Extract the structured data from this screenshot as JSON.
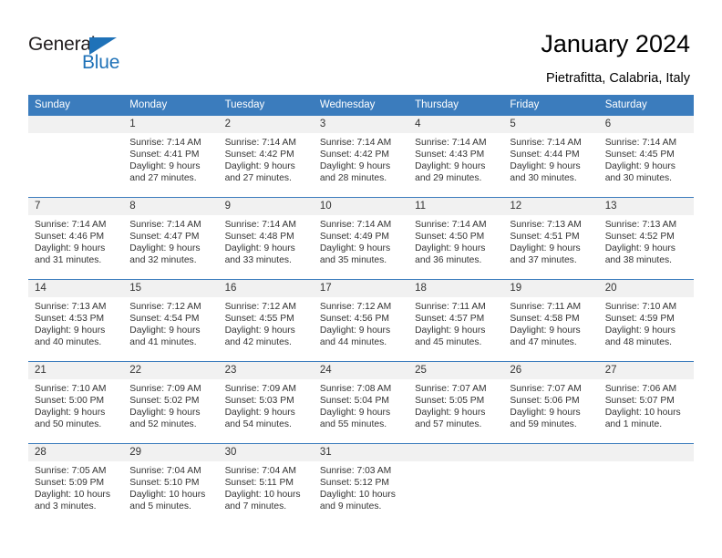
{
  "brand": {
    "name_dark": "General",
    "name_blue": "Blue",
    "accent_color": "#1f72b8"
  },
  "header": {
    "title": "January 2024",
    "subtitle": "Pietrafitta, Calabria, Italy",
    "header_bg": "#3b7cbd",
    "band_bg": "#f1f1f1"
  },
  "weekday_headers": [
    "Sunday",
    "Monday",
    "Tuesday",
    "Wednesday",
    "Thursday",
    "Friday",
    "Saturday"
  ],
  "labels": {
    "sunrise": "Sunrise:",
    "sunset": "Sunset:",
    "daylight": "Daylight:"
  },
  "weeks": [
    [
      {
        "day": "",
        "empty": true,
        "l1": "",
        "l2": "",
        "l3": "",
        "l4": ""
      },
      {
        "day": "1",
        "l1": "Sunrise: 7:14 AM",
        "l2": "Sunset: 4:41 PM",
        "l3": "Daylight: 9 hours",
        "l4": "and 27 minutes."
      },
      {
        "day": "2",
        "l1": "Sunrise: 7:14 AM",
        "l2": "Sunset: 4:42 PM",
        "l3": "Daylight: 9 hours",
        "l4": "and 27 minutes."
      },
      {
        "day": "3",
        "l1": "Sunrise: 7:14 AM",
        "l2": "Sunset: 4:42 PM",
        "l3": "Daylight: 9 hours",
        "l4": "and 28 minutes."
      },
      {
        "day": "4",
        "l1": "Sunrise: 7:14 AM",
        "l2": "Sunset: 4:43 PM",
        "l3": "Daylight: 9 hours",
        "l4": "and 29 minutes."
      },
      {
        "day": "5",
        "l1": "Sunrise: 7:14 AM",
        "l2": "Sunset: 4:44 PM",
        "l3": "Daylight: 9 hours",
        "l4": "and 30 minutes."
      },
      {
        "day": "6",
        "l1": "Sunrise: 7:14 AM",
        "l2": "Sunset: 4:45 PM",
        "l3": "Daylight: 9 hours",
        "l4": "and 30 minutes."
      }
    ],
    [
      {
        "day": "7",
        "l1": "Sunrise: 7:14 AM",
        "l2": "Sunset: 4:46 PM",
        "l3": "Daylight: 9 hours",
        "l4": "and 31 minutes."
      },
      {
        "day": "8",
        "l1": "Sunrise: 7:14 AM",
        "l2": "Sunset: 4:47 PM",
        "l3": "Daylight: 9 hours",
        "l4": "and 32 minutes."
      },
      {
        "day": "9",
        "l1": "Sunrise: 7:14 AM",
        "l2": "Sunset: 4:48 PM",
        "l3": "Daylight: 9 hours",
        "l4": "and 33 minutes."
      },
      {
        "day": "10",
        "l1": "Sunrise: 7:14 AM",
        "l2": "Sunset: 4:49 PM",
        "l3": "Daylight: 9 hours",
        "l4": "and 35 minutes."
      },
      {
        "day": "11",
        "l1": "Sunrise: 7:14 AM",
        "l2": "Sunset: 4:50 PM",
        "l3": "Daylight: 9 hours",
        "l4": "and 36 minutes."
      },
      {
        "day": "12",
        "l1": "Sunrise: 7:13 AM",
        "l2": "Sunset: 4:51 PM",
        "l3": "Daylight: 9 hours",
        "l4": "and 37 minutes."
      },
      {
        "day": "13",
        "l1": "Sunrise: 7:13 AM",
        "l2": "Sunset: 4:52 PM",
        "l3": "Daylight: 9 hours",
        "l4": "and 38 minutes."
      }
    ],
    [
      {
        "day": "14",
        "l1": "Sunrise: 7:13 AM",
        "l2": "Sunset: 4:53 PM",
        "l3": "Daylight: 9 hours",
        "l4": "and 40 minutes."
      },
      {
        "day": "15",
        "l1": "Sunrise: 7:12 AM",
        "l2": "Sunset: 4:54 PM",
        "l3": "Daylight: 9 hours",
        "l4": "and 41 minutes."
      },
      {
        "day": "16",
        "l1": "Sunrise: 7:12 AM",
        "l2": "Sunset: 4:55 PM",
        "l3": "Daylight: 9 hours",
        "l4": "and 42 minutes."
      },
      {
        "day": "17",
        "l1": "Sunrise: 7:12 AM",
        "l2": "Sunset: 4:56 PM",
        "l3": "Daylight: 9 hours",
        "l4": "and 44 minutes."
      },
      {
        "day": "18",
        "l1": "Sunrise: 7:11 AM",
        "l2": "Sunset: 4:57 PM",
        "l3": "Daylight: 9 hours",
        "l4": "and 45 minutes."
      },
      {
        "day": "19",
        "l1": "Sunrise: 7:11 AM",
        "l2": "Sunset: 4:58 PM",
        "l3": "Daylight: 9 hours",
        "l4": "and 47 minutes."
      },
      {
        "day": "20",
        "l1": "Sunrise: 7:10 AM",
        "l2": "Sunset: 4:59 PM",
        "l3": "Daylight: 9 hours",
        "l4": "and 48 minutes."
      }
    ],
    [
      {
        "day": "21",
        "l1": "Sunrise: 7:10 AM",
        "l2": "Sunset: 5:00 PM",
        "l3": "Daylight: 9 hours",
        "l4": "and 50 minutes."
      },
      {
        "day": "22",
        "l1": "Sunrise: 7:09 AM",
        "l2": "Sunset: 5:02 PM",
        "l3": "Daylight: 9 hours",
        "l4": "and 52 minutes."
      },
      {
        "day": "23",
        "l1": "Sunrise: 7:09 AM",
        "l2": "Sunset: 5:03 PM",
        "l3": "Daylight: 9 hours",
        "l4": "and 54 minutes."
      },
      {
        "day": "24",
        "l1": "Sunrise: 7:08 AM",
        "l2": "Sunset: 5:04 PM",
        "l3": "Daylight: 9 hours",
        "l4": "and 55 minutes."
      },
      {
        "day": "25",
        "l1": "Sunrise: 7:07 AM",
        "l2": "Sunset: 5:05 PM",
        "l3": "Daylight: 9 hours",
        "l4": "and 57 minutes."
      },
      {
        "day": "26",
        "l1": "Sunrise: 7:07 AM",
        "l2": "Sunset: 5:06 PM",
        "l3": "Daylight: 9 hours",
        "l4": "and 59 minutes."
      },
      {
        "day": "27",
        "l1": "Sunrise: 7:06 AM",
        "l2": "Sunset: 5:07 PM",
        "l3": "Daylight: 10 hours",
        "l4": "and 1 minute."
      }
    ],
    [
      {
        "day": "28",
        "l1": "Sunrise: 7:05 AM",
        "l2": "Sunset: 5:09 PM",
        "l3": "Daylight: 10 hours",
        "l4": "and 3 minutes."
      },
      {
        "day": "29",
        "l1": "Sunrise: 7:04 AM",
        "l2": "Sunset: 5:10 PM",
        "l3": "Daylight: 10 hours",
        "l4": "and 5 minutes."
      },
      {
        "day": "30",
        "l1": "Sunrise: 7:04 AM",
        "l2": "Sunset: 5:11 PM",
        "l3": "Daylight: 10 hours",
        "l4": "and 7 minutes."
      },
      {
        "day": "31",
        "l1": "Sunrise: 7:03 AM",
        "l2": "Sunset: 5:12 PM",
        "l3": "Daylight: 10 hours",
        "l4": "and 9 minutes."
      },
      {
        "day": "",
        "empty": true,
        "l1": "",
        "l2": "",
        "l3": "",
        "l4": ""
      },
      {
        "day": "",
        "empty": true,
        "l1": "",
        "l2": "",
        "l3": "",
        "l4": ""
      },
      {
        "day": "",
        "empty": true,
        "l1": "",
        "l2": "",
        "l3": "",
        "l4": ""
      }
    ]
  ]
}
